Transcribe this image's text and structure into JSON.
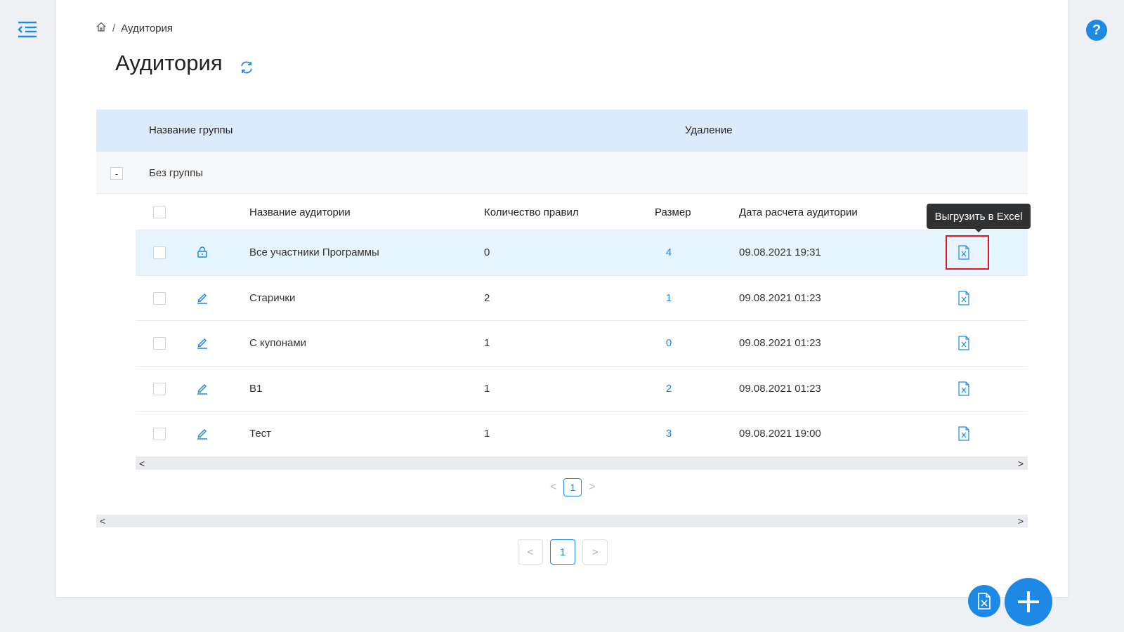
{
  "breadcrumb": {
    "items": [
      "Аудитория"
    ]
  },
  "page_title": "Аудитория",
  "outer_table": {
    "col_name": "Название группы",
    "col_delete": "Удаление"
  },
  "group": {
    "collapse": "-",
    "label": "Без группы"
  },
  "inner_table": {
    "headers": {
      "name": "Название аудитории",
      "rules": "Количество правил",
      "size": "Размер",
      "date": "Дата расчета аудитории"
    },
    "rows": [
      {
        "icon": "lock-icon",
        "name": "Все участники Программы",
        "rules": "0",
        "size": "4",
        "date": "09.08.2021 19:31"
      },
      {
        "icon": "edit-icon",
        "name": "Старички",
        "rules": "2",
        "size": "1",
        "date": "09.08.2021 01:23"
      },
      {
        "icon": "edit-icon",
        "name": "С купонами",
        "rules": "1",
        "size": "0",
        "date": "09.08.2021 01:23"
      },
      {
        "icon": "edit-icon",
        "name": "В1",
        "rules": "1",
        "size": "2",
        "date": "09.08.2021 01:23"
      },
      {
        "icon": "edit-icon",
        "name": "Тест",
        "rules": "1",
        "size": "3",
        "date": "09.08.2021 19:00"
      }
    ]
  },
  "tooltip": "Выгрузить в Excel",
  "inner_pagination": {
    "page": "1"
  },
  "outer_pagination": {
    "page": "1"
  },
  "scroll": {
    "left": "<",
    "right": ">"
  },
  "pager_arrows": {
    "prev": "<",
    "next": ">"
  },
  "help": "?",
  "colors": {
    "accent": "#1e88e5",
    "header_bg": "#dcebfb",
    "highlight_row": "#e6f4fd",
    "annotation": "#e8141f"
  }
}
